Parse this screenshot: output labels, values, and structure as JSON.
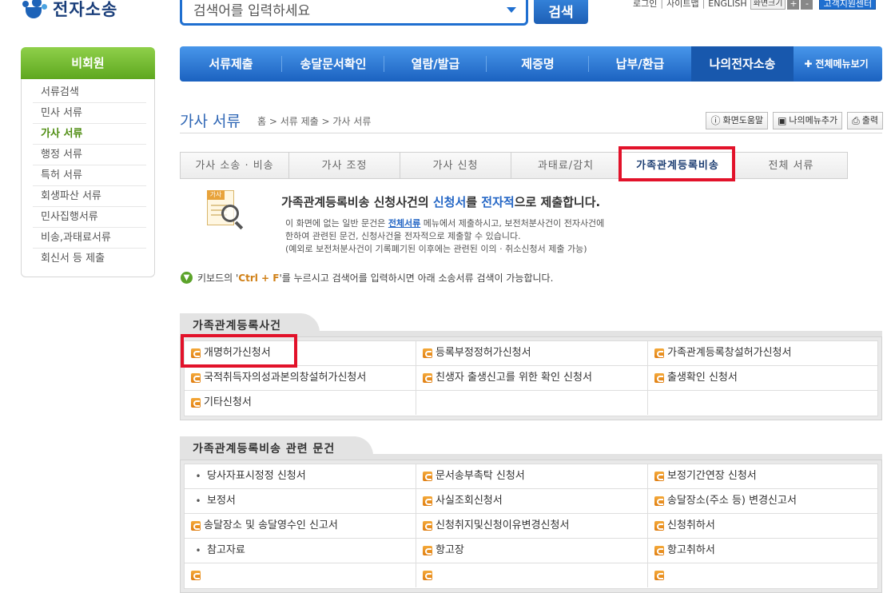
{
  "header": {
    "logo_text": "전자소송",
    "search_placeholder": "검색어를 입력하세요",
    "search_button": "검색",
    "util": {
      "login": "로그인",
      "sitemap": "사이트맵",
      "english": "ENGLISH",
      "zoom_label": "화면크기",
      "zoom_in": "+",
      "zoom_out": "-",
      "customer_center": "고객지원센터"
    }
  },
  "sidebar": {
    "title": "비회원",
    "items": [
      {
        "label": "서류검색"
      },
      {
        "label": "민사 서류"
      },
      {
        "label": "가사 서류"
      },
      {
        "label": "행정 서류"
      },
      {
        "label": "특허 서류"
      },
      {
        "label": "회생파산 서류"
      },
      {
        "label": "민사집행서류"
      },
      {
        "label": "비송,과태료서류"
      },
      {
        "label": "회신서 등 제출"
      }
    ],
    "active_index": 2
  },
  "nav": {
    "items": [
      {
        "label": "서류제출"
      },
      {
        "label": "송달문서확인"
      },
      {
        "label": "열람/발급"
      },
      {
        "label": "제증명"
      },
      {
        "label": "납부/환급"
      },
      {
        "label": "나의전자소송"
      }
    ],
    "all_menu": "전체메뉴보기"
  },
  "page": {
    "title": "가사 서류",
    "breadcrumb": "홈 > 서류 제출 > 가사 서류",
    "tools": {
      "help": "화면도움말",
      "add_menu": "나의메뉴추가",
      "print": "출력"
    }
  },
  "tabs": [
    {
      "label": "가사 소송 · 비송"
    },
    {
      "label": "가사 조정"
    },
    {
      "label": "가사 신청"
    },
    {
      "label": "과태료/감치"
    },
    {
      "label": "가족관계등록비송"
    },
    {
      "label": "전체 서류"
    }
  ],
  "intro": {
    "icon_tag": "가사",
    "title_part1": "가족관계등록비송 신청사건의 ",
    "title_part2": "신청서",
    "title_part3": "를 ",
    "title_part4": "전자적",
    "title_part5": "으로 제출합니다.",
    "line1_a": "이 화면에 없는 일반 문건은 ",
    "line1_link": "전체서류",
    "line1_b": " 메뉴에서 제출하시고, 보전처분사건이 전자사건에",
    "line2": "한하여 관련된 문건, 신청사건을 전자적으로 제출할 수 있습니다.",
    "line3": "(예외로 보전처분사건이 기록폐기된 이후에는 관련된 이의 · 취소신청서 제출 가능)"
  },
  "kb_tip": {
    "prefix": "키보드의 '",
    "key": "Ctrl + F",
    "suffix": "'를 누르시고 검색어를 입력하시면 아래 소송서류 검색이 가능합니다."
  },
  "section1": {
    "title": "가족관계등록사건",
    "rows": [
      [
        {
          "icon": "doc",
          "label": "개명허가신청서"
        },
        {
          "icon": "doc",
          "label": "등록부정정허가신청서"
        },
        {
          "icon": "doc",
          "label": "가족관계등록창설허가신청서"
        }
      ],
      [
        {
          "icon": "doc",
          "label": "국적취득자의성과본의창설허가신청서"
        },
        {
          "icon": "doc",
          "label": "친생자 출생신고를 위한 확인 신청서"
        },
        {
          "icon": "doc",
          "label": "출생확인 신청서"
        }
      ],
      [
        {
          "icon": "doc",
          "label": "기타신청서"
        },
        {
          "icon": "",
          "label": ""
        },
        {
          "icon": "",
          "label": ""
        }
      ]
    ]
  },
  "section2": {
    "title": "가족관계등록비송 관련 문건",
    "rows": [
      [
        {
          "icon": "dot",
          "label": "당사자표시정정 신청서"
        },
        {
          "icon": "doc",
          "label": "문서송부촉탁 신청서"
        },
        {
          "icon": "doc",
          "label": "보정기간연장 신청서"
        }
      ],
      [
        {
          "icon": "dot",
          "label": "보정서"
        },
        {
          "icon": "doc",
          "label": "사실조회신청서"
        },
        {
          "icon": "doc",
          "label": "송달장소(주소 등) 변경신고서"
        }
      ],
      [
        {
          "icon": "doc",
          "label": "송달장소 및 송달영수인 신고서"
        },
        {
          "icon": "doc",
          "label": "신청취지및신청이유변경신청서"
        },
        {
          "icon": "doc",
          "label": "신청취하서"
        }
      ],
      [
        {
          "icon": "dot",
          "label": "참고자료"
        },
        {
          "icon": "doc",
          "label": "항고장"
        },
        {
          "icon": "doc",
          "label": "항고취하서"
        }
      ],
      [
        {
          "icon": "doc",
          "label": ""
        },
        {
          "icon": "doc",
          "label": ""
        },
        {
          "icon": "doc",
          "label": ""
        }
      ]
    ]
  },
  "colors": {
    "primary_blue": "#1f6fd0",
    "sidebar_green": "#6fb52c",
    "highlight_red": "#e2122a",
    "doc_icon_orange": "#ed9425"
  }
}
